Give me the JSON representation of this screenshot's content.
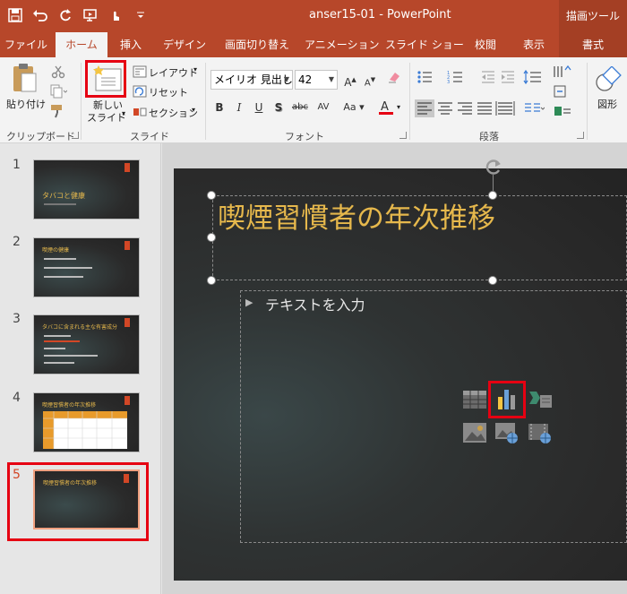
{
  "window": {
    "title": "anser15-01 - PowerPoint",
    "contextual_label": "描画ツール"
  },
  "tabs": [
    {
      "label": "ファイル"
    },
    {
      "label": "ホーム"
    },
    {
      "label": "挿入"
    },
    {
      "label": "デザイン"
    },
    {
      "label": "画面切り替え"
    },
    {
      "label": "アニメーション"
    },
    {
      "label": "スライド ショー"
    },
    {
      "label": "校閲"
    },
    {
      "label": "表示"
    },
    {
      "label": "書式"
    }
  ],
  "ribbon": {
    "clipboard": {
      "paste_label": "貼り付け",
      "group_label": "クリップボード"
    },
    "slides": {
      "new_slide_line1": "新しい",
      "new_slide_line2": "スライド",
      "layout_label": "レイアウト",
      "reset_label": "リセット",
      "section_label": "セクション",
      "group_label": "スライド"
    },
    "font": {
      "font_name": "メイリオ 見出し",
      "font_size": "42",
      "group_label": "フォント"
    },
    "paragraph": {
      "group_label": "段落"
    },
    "drawing": {
      "shapes_label": "図形"
    }
  },
  "slides": [
    {
      "number": "1",
      "title": "タバコと健康"
    },
    {
      "number": "2",
      "title": "喫煙の健康"
    },
    {
      "number": "3",
      "title": "タバコに含まれる主な有害成分"
    },
    {
      "number": "4",
      "title": "喫煙習慣者の年次推移"
    },
    {
      "number": "5",
      "title": "喫煙習慣者の年次推移"
    }
  ],
  "current_slide": {
    "title": "喫煙習慣者の年次推移",
    "body_placeholder": "テキストを入力"
  },
  "colors": {
    "brand": "#b7472a",
    "accent_title": "#e6b84c",
    "highlight": "#e60012"
  }
}
